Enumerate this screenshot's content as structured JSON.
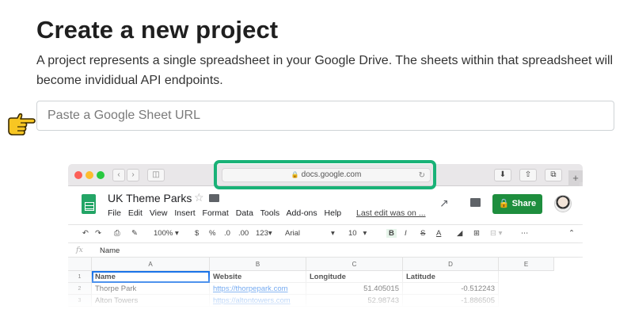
{
  "header": {
    "title": "Create a new project",
    "description": "A project represents a single spreadsheet in your Google Drive. The sheets within that spreadsheet will become invididual API endpoints."
  },
  "url_input": {
    "placeholder": "Paste a Google Sheet URL",
    "value": ""
  },
  "browser": {
    "address": "docs.google.com",
    "plus_label": "+"
  },
  "sheet": {
    "title": "UK Theme Parks",
    "menu": [
      "File",
      "Edit",
      "View",
      "Insert",
      "Format",
      "Data",
      "Tools",
      "Add-ons",
      "Help"
    ],
    "last_edit": "Last edit was on ...",
    "share_label": "Share",
    "toolbar": {
      "zoom": "100%",
      "currency": "$",
      "percent": "%",
      "dec_less": ".0",
      "dec_more": ".00",
      "more_formats": "123",
      "font": "Arial",
      "font_size": "10",
      "bold": "B",
      "italic": "I",
      "strike": "S",
      "text_color": "A",
      "more": "⋯"
    },
    "fx_value": "Name",
    "columns": [
      "A",
      "B",
      "C",
      "D",
      "E"
    ],
    "rows": [
      {
        "num": "1",
        "name": "Name",
        "website": "Website",
        "longitude": "Longitude",
        "latitude": "Latitude"
      },
      {
        "num": "2",
        "name": "Thorpe Park",
        "website": "https://thorpepark.com",
        "longitude": "51.405015",
        "latitude": "-0.512243"
      },
      {
        "num": "3",
        "name": "Alton Towers",
        "website": "https://altontowers.com",
        "longitude": "52.98743",
        "latitude": "-1.886505"
      }
    ]
  },
  "colors": {
    "highlight": "#19b277",
    "share": "#1e8e3e",
    "sheets_logo": "#23a566",
    "hand": "#f7c623"
  },
  "icons": {
    "pointer": "hand-pointing-right-icon"
  }
}
